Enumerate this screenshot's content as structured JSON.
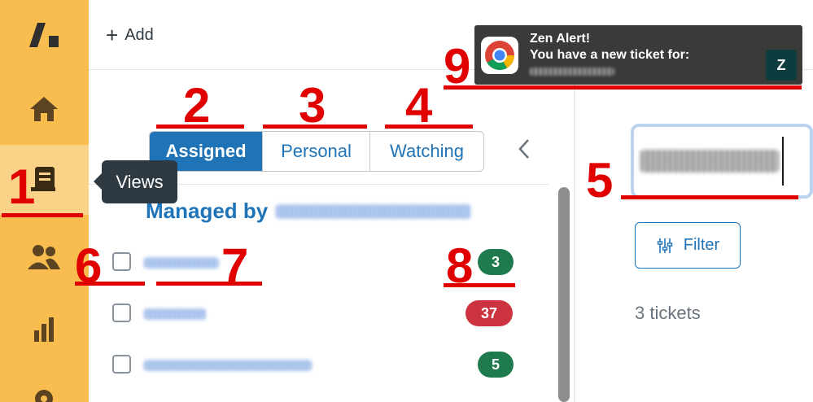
{
  "topbar": {
    "add_label": "Add",
    "add_icon": "plus-icon"
  },
  "sidebar": {
    "items": [
      {
        "name": "logo",
        "icon": "zendesk-logo-icon"
      },
      {
        "name": "home",
        "icon": "home-icon"
      },
      {
        "name": "views",
        "icon": "views-icon",
        "active": true
      },
      {
        "name": "customers",
        "icon": "users-icon"
      },
      {
        "name": "reporting",
        "icon": "bar-chart-icon"
      },
      {
        "name": "admin",
        "icon": "gear-icon"
      }
    ],
    "tooltip": "Views",
    "color": "#f9bc4e",
    "active_color": "#fbd388"
  },
  "views": {
    "tabs": [
      {
        "label": "Assigned",
        "active": true
      },
      {
        "label": "Personal"
      },
      {
        "label": "Watching"
      }
    ],
    "managed_prefix": "Managed by",
    "rows": [
      {
        "count": "3",
        "badge_color": "#1f7a4d"
      },
      {
        "count": "37",
        "badge_color": "#cc3340"
      },
      {
        "count": "5",
        "badge_color": "#1f7a4d"
      }
    ]
  },
  "main": {
    "filter_label": "Filter",
    "tickets_count": "3 tickets"
  },
  "notification": {
    "title": "Zen Alert!",
    "body": "You have a new ticket for:",
    "app_icon": "chrome-icon",
    "badge_icon": "zendesk-icon"
  },
  "annotations": [
    "1",
    "2",
    "3",
    "4",
    "5",
    "6",
    "7",
    "8",
    "9"
  ],
  "accent_color": "#1f73b7",
  "annotation_color": "#e00000"
}
